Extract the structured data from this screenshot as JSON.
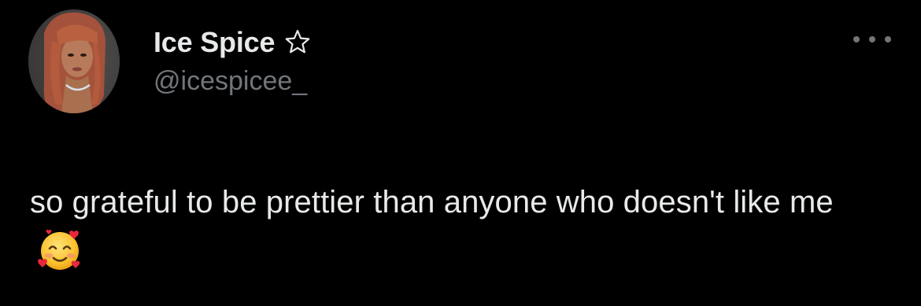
{
  "author": {
    "display_name": "Ice Spice",
    "name_icon": "star-outline-icon",
    "handle": "@icespicee_"
  },
  "tweet": {
    "text": "so grateful to be prettier than anyone who doesn't like me",
    "emoji": "smiling-face-with-hearts-icon"
  },
  "menu": {
    "more_icon": "more-horizontal-icon"
  },
  "colors": {
    "background": "#000000",
    "primary_text": "#e7e9ea",
    "secondary_text": "#71767b"
  }
}
